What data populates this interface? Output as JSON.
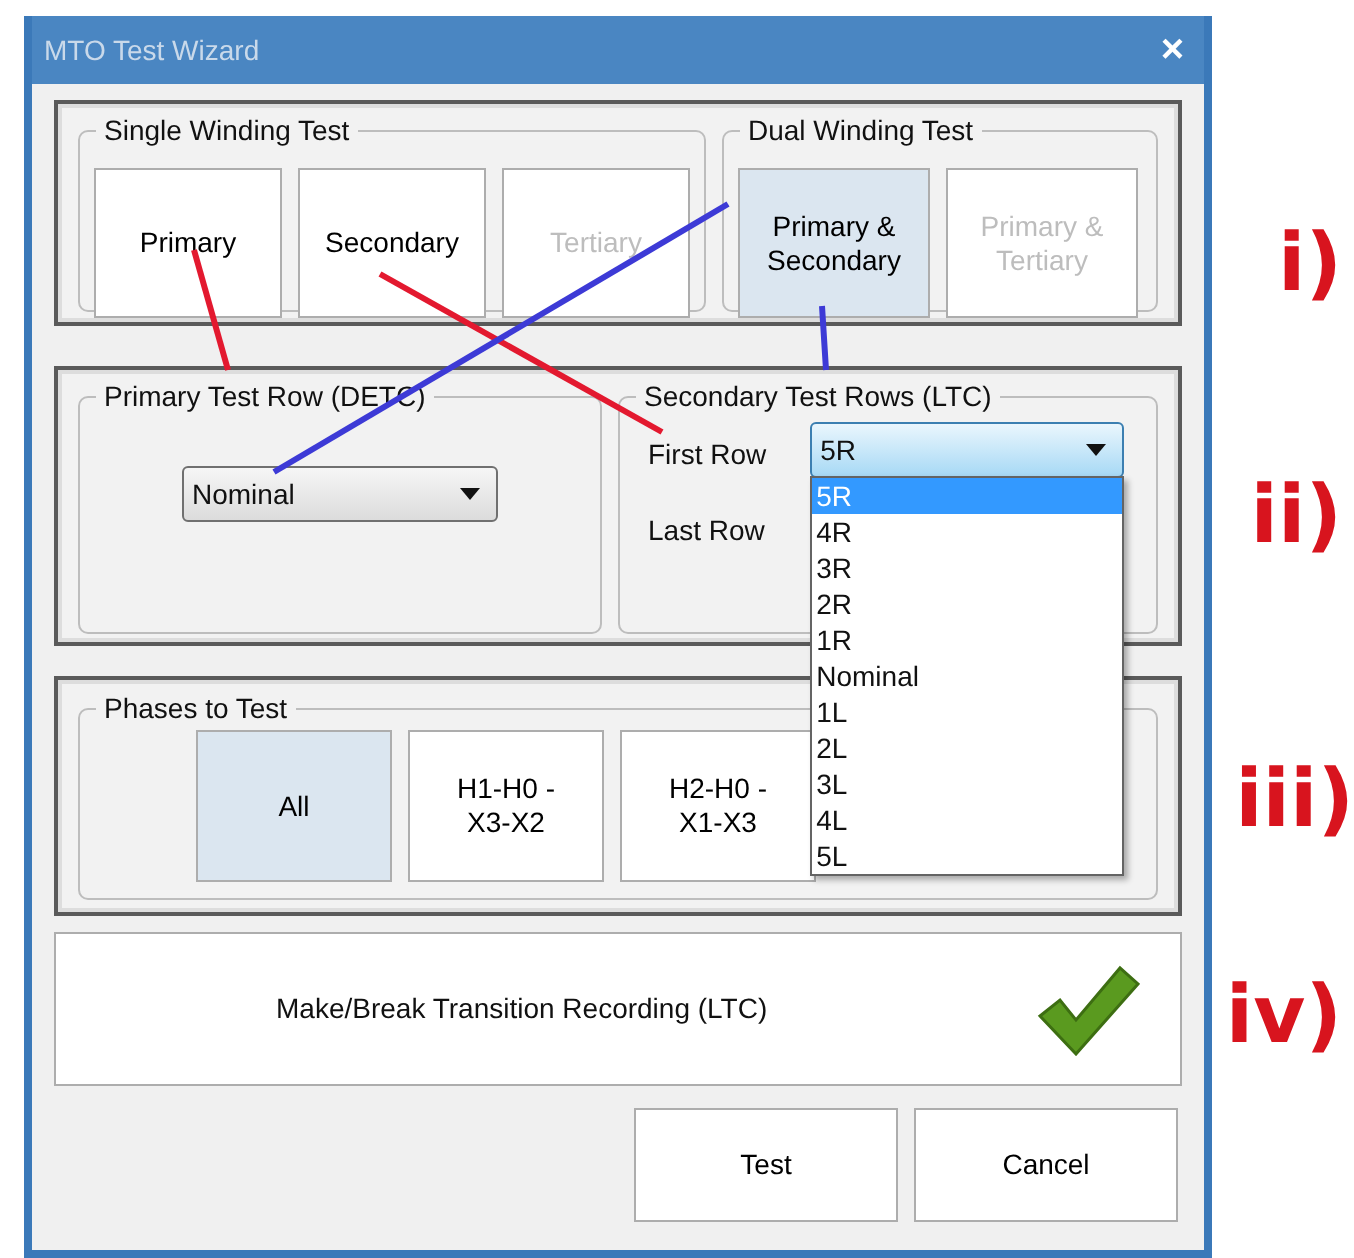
{
  "window": {
    "title": "MTO Test Wizard",
    "close": "×"
  },
  "winding_test": {
    "single": {
      "label": "Single Winding Test",
      "options": [
        {
          "label": "Primary",
          "selected": false,
          "disabled": false
        },
        {
          "label": "Secondary",
          "selected": false,
          "disabled": false
        },
        {
          "label": "Tertiary",
          "selected": false,
          "disabled": true
        }
      ]
    },
    "dual": {
      "label": "Dual Winding Test",
      "options": [
        {
          "label": "Primary & Secondary",
          "selected": true,
          "disabled": false
        },
        {
          "label": "Primary & Tertiary",
          "selected": false,
          "disabled": true
        }
      ]
    }
  },
  "test_rows": {
    "primary": {
      "label": "Primary Test Row (DETC)",
      "value": "Nominal"
    },
    "secondary": {
      "label": "Secondary Test Rows (LTC)",
      "first_row": {
        "label": "First Row",
        "value": "5R",
        "expanded": true,
        "options": [
          {
            "label": "5R",
            "selected": true
          },
          {
            "label": "4R",
            "selected": false
          },
          {
            "label": "3R",
            "selected": false
          },
          {
            "label": "2R",
            "selected": false
          },
          {
            "label": "1R",
            "selected": false
          },
          {
            "label": "Nominal",
            "selected": false
          },
          {
            "label": "1L",
            "selected": false
          },
          {
            "label": "2L",
            "selected": false
          },
          {
            "label": "3L",
            "selected": false
          },
          {
            "label": "4L",
            "selected": false
          },
          {
            "label": "5L",
            "selected": false
          }
        ]
      },
      "last_row": {
        "label": "Last Row"
      }
    }
  },
  "phases": {
    "label": "Phases to Test",
    "options": [
      {
        "label": "All",
        "selected": true
      },
      {
        "label": "H1-H0 -\nX3-X2",
        "selected": false
      },
      {
        "label": "H2-H0 -\nX1-X3",
        "selected": false
      }
    ]
  },
  "transition_recording": {
    "label": "Make/Break Transition Recording (LTC)",
    "checked": true
  },
  "buttons": [
    {
      "label": "Test"
    },
    {
      "label": "Cancel"
    }
  ],
  "annotations": [
    {
      "label": "i)"
    },
    {
      "label": "ii)"
    },
    {
      "label": "iii)"
    },
    {
      "label": "iv)"
    }
  ],
  "connectors": [
    {
      "color": "#e3192f"
    },
    {
      "color": "#e3192f"
    },
    {
      "color": "#3d3ad6"
    },
    {
      "color": "#3d3ad6"
    }
  ]
}
